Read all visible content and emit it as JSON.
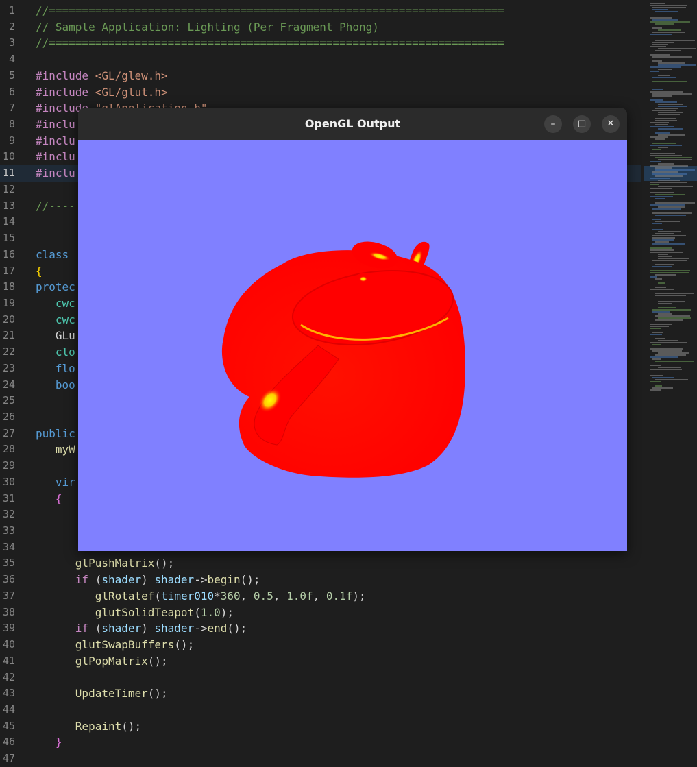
{
  "window": {
    "title": "OpenGL Output",
    "minimize_glyph": "–",
    "maximize_glyph": "□",
    "close_glyph": "✕",
    "viewport_background": "#8080ff",
    "object_color": "#ff0000",
    "highlight_color": "#ffff00"
  },
  "editor": {
    "active_line": 11,
    "lines": [
      {
        "n": "1",
        "t": [
          {
            "c": "comment",
            "s": "//====================================================================="
          }
        ]
      },
      {
        "n": "2",
        "t": [
          {
            "c": "comment",
            "s": "// Sample Application: Lighting (Per Fragment Phong)"
          }
        ]
      },
      {
        "n": "3",
        "t": [
          {
            "c": "comment",
            "s": "//====================================================================="
          }
        ]
      },
      {
        "n": "4",
        "t": []
      },
      {
        "n": "5",
        "t": [
          {
            "c": "pre",
            "s": "#include "
          },
          {
            "c": "str",
            "s": "<GL/glew.h>"
          }
        ]
      },
      {
        "n": "6",
        "t": [
          {
            "c": "pre",
            "s": "#include "
          },
          {
            "c": "str",
            "s": "<GL/glut.h>"
          }
        ]
      },
      {
        "n": "7",
        "t": [
          {
            "c": "pre",
            "s": "#include "
          },
          {
            "c": "str",
            "s": "\"glApplication.h\""
          }
        ]
      },
      {
        "n": "8",
        "t": [
          {
            "c": "pre",
            "s": "#inclu"
          }
        ]
      },
      {
        "n": "9",
        "t": [
          {
            "c": "pre",
            "s": "#inclu"
          }
        ]
      },
      {
        "n": "10",
        "t": [
          {
            "c": "pre",
            "s": "#inclu"
          }
        ]
      },
      {
        "n": "11",
        "t": [
          {
            "c": "pre",
            "s": "#inclu"
          }
        ]
      },
      {
        "n": "12",
        "t": []
      },
      {
        "n": "13",
        "t": [
          {
            "c": "comment",
            "s": "//----"
          }
        ]
      },
      {
        "n": "14",
        "t": []
      },
      {
        "n": "15",
        "t": []
      },
      {
        "n": "16",
        "t": [
          {
            "c": "kw",
            "s": "class"
          }
        ]
      },
      {
        "n": "17",
        "t": [
          {
            "c": "brace",
            "s": "{"
          }
        ]
      },
      {
        "n": "18",
        "t": [
          {
            "c": "kw",
            "s": "protec"
          }
        ]
      },
      {
        "n": "19",
        "t": [
          {
            "c": "plain",
            "s": "   "
          },
          {
            "c": "type",
            "s": "cwc"
          }
        ]
      },
      {
        "n": "20",
        "t": [
          {
            "c": "plain",
            "s": "   "
          },
          {
            "c": "type",
            "s": "cwc"
          }
        ]
      },
      {
        "n": "21",
        "t": [
          {
            "c": "plain",
            "s": "   "
          },
          {
            "c": "plain",
            "s": "GLu"
          }
        ]
      },
      {
        "n": "22",
        "t": [
          {
            "c": "plain",
            "s": "   "
          },
          {
            "c": "type",
            "s": "clo"
          }
        ]
      },
      {
        "n": "23",
        "t": [
          {
            "c": "plain",
            "s": "   "
          },
          {
            "c": "kw",
            "s": "flo"
          }
        ]
      },
      {
        "n": "24",
        "t": [
          {
            "c": "plain",
            "s": "   "
          },
          {
            "c": "kw",
            "s": "boo"
          }
        ]
      },
      {
        "n": "25",
        "t": []
      },
      {
        "n": "26",
        "t": []
      },
      {
        "n": "27",
        "t": [
          {
            "c": "kw",
            "s": "public"
          }
        ]
      },
      {
        "n": "28",
        "t": [
          {
            "c": "plain",
            "s": "   "
          },
          {
            "c": "fn",
            "s": "myW"
          }
        ]
      },
      {
        "n": "29",
        "t": []
      },
      {
        "n": "30",
        "t": [
          {
            "c": "plain",
            "s": "   "
          },
          {
            "c": "kw",
            "s": "vir"
          }
        ]
      },
      {
        "n": "31",
        "t": [
          {
            "c": "plain",
            "s": "   "
          },
          {
            "c": "brace2",
            "s": "{"
          }
        ]
      },
      {
        "n": "32",
        "t": []
      },
      {
        "n": "33",
        "t": []
      },
      {
        "n": "34",
        "t": []
      },
      {
        "n": "35",
        "t": [
          {
            "c": "plain",
            "s": "      "
          },
          {
            "c": "fn",
            "s": "glPushMatrix"
          },
          {
            "c": "plain",
            "s": "();"
          }
        ]
      },
      {
        "n": "36",
        "t": [
          {
            "c": "plain",
            "s": "      "
          },
          {
            "c": "cf",
            "s": "if"
          },
          {
            "c": "plain",
            "s": " ("
          },
          {
            "c": "var",
            "s": "shader"
          },
          {
            "c": "plain",
            "s": ") "
          },
          {
            "c": "var",
            "s": "shader"
          },
          {
            "c": "plain",
            "s": "->"
          },
          {
            "c": "fn",
            "s": "begin"
          },
          {
            "c": "plain",
            "s": "();"
          }
        ]
      },
      {
        "n": "37",
        "t": [
          {
            "c": "plain",
            "s": "         "
          },
          {
            "c": "fn",
            "s": "glRotatef"
          },
          {
            "c": "plain",
            "s": "("
          },
          {
            "c": "var",
            "s": "timer010"
          },
          {
            "c": "plain",
            "s": "*"
          },
          {
            "c": "num",
            "s": "360"
          },
          {
            "c": "plain",
            "s": ", "
          },
          {
            "c": "num",
            "s": "0.5"
          },
          {
            "c": "plain",
            "s": ", "
          },
          {
            "c": "num",
            "s": "1.0f"
          },
          {
            "c": "plain",
            "s": ", "
          },
          {
            "c": "num",
            "s": "0.1f"
          },
          {
            "c": "plain",
            "s": ");"
          }
        ]
      },
      {
        "n": "38",
        "t": [
          {
            "c": "plain",
            "s": "         "
          },
          {
            "c": "fn",
            "s": "glutSolidTeapot"
          },
          {
            "c": "plain",
            "s": "("
          },
          {
            "c": "num",
            "s": "1.0"
          },
          {
            "c": "plain",
            "s": ");"
          }
        ]
      },
      {
        "n": "39",
        "t": [
          {
            "c": "plain",
            "s": "      "
          },
          {
            "c": "cf",
            "s": "if"
          },
          {
            "c": "plain",
            "s": " ("
          },
          {
            "c": "var",
            "s": "shader"
          },
          {
            "c": "plain",
            "s": ") "
          },
          {
            "c": "var",
            "s": "shader"
          },
          {
            "c": "plain",
            "s": "->"
          },
          {
            "c": "fn",
            "s": "end"
          },
          {
            "c": "plain",
            "s": "();"
          }
        ]
      },
      {
        "n": "40",
        "t": [
          {
            "c": "plain",
            "s": "      "
          },
          {
            "c": "fn",
            "s": "glutSwapBuffers"
          },
          {
            "c": "plain",
            "s": "();"
          }
        ]
      },
      {
        "n": "41",
        "t": [
          {
            "c": "plain",
            "s": "      "
          },
          {
            "c": "fn",
            "s": "glPopMatrix"
          },
          {
            "c": "plain",
            "s": "();"
          }
        ]
      },
      {
        "n": "42",
        "t": []
      },
      {
        "n": "43",
        "t": [
          {
            "c": "plain",
            "s": "      "
          },
          {
            "c": "fn",
            "s": "UpdateTimer"
          },
          {
            "c": "plain",
            "s": "();"
          }
        ]
      },
      {
        "n": "44",
        "t": []
      },
      {
        "n": "45",
        "t": [
          {
            "c": "plain",
            "s": "      "
          },
          {
            "c": "fn",
            "s": "Repaint"
          },
          {
            "c": "plain",
            "s": "();"
          }
        ]
      },
      {
        "n": "46",
        "t": [
          {
            "c": "plain",
            "s": "   "
          },
          {
            "c": "brace2",
            "s": "}"
          }
        ]
      },
      {
        "n": "47",
        "t": []
      }
    ]
  }
}
